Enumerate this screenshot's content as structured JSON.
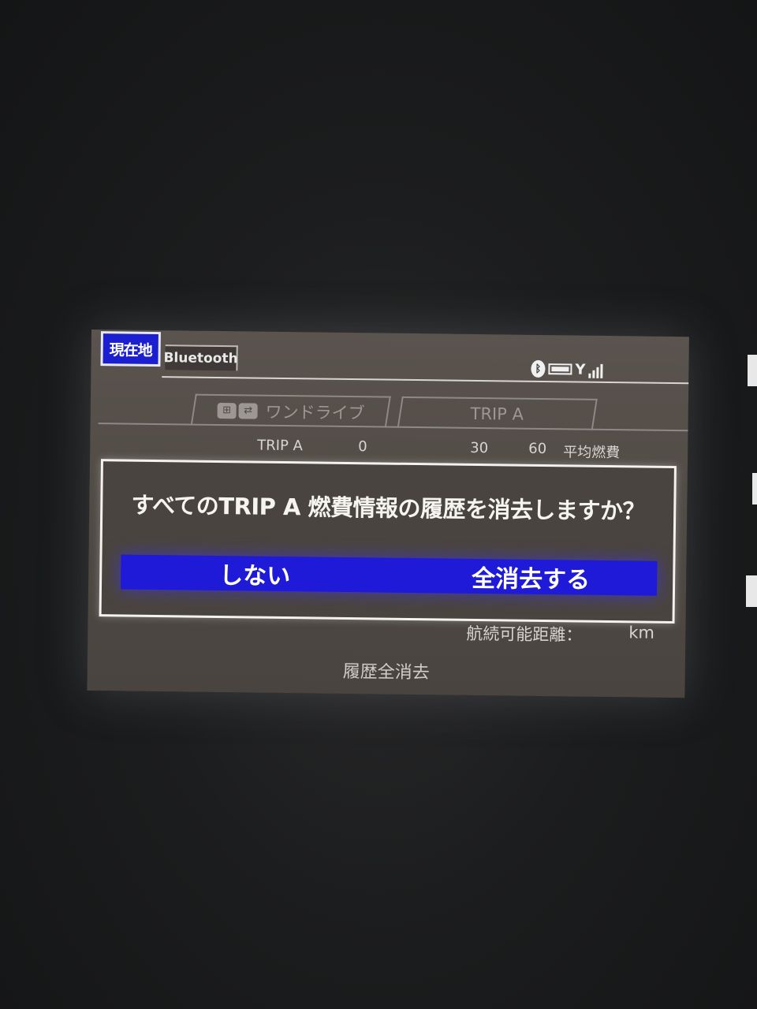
{
  "statusbar": {
    "current_location_label": "現在地",
    "bluetooth_tab_label": "Bluetooth"
  },
  "status_icons": {
    "bluetooth_icon": "bluetooth-icon",
    "battery_icon": "battery-icon",
    "signal_icon": "signal-icon"
  },
  "tabs": [
    {
      "label": "ワンドライブ",
      "icon": "drive-mode-icon"
    },
    {
      "label": "TRIP A"
    }
  ],
  "scale": {
    "series_label": "TRIP A",
    "ticks": [
      "0",
      "30",
      "60"
    ],
    "unit_label": "平均燃費"
  },
  "dialog": {
    "message": "すべてのTRIP A 燃費情報の履歴を消去しますか？",
    "option_no": "しない",
    "option_yes": "全消去する"
  },
  "range": {
    "label": "航続可能距離：",
    "unit": "km"
  },
  "footer": {
    "label": "履歴全消去"
  },
  "colors": {
    "accent": "#1f1ad8",
    "screen_bg": "#4f4944",
    "text": "#f5f4f0"
  }
}
